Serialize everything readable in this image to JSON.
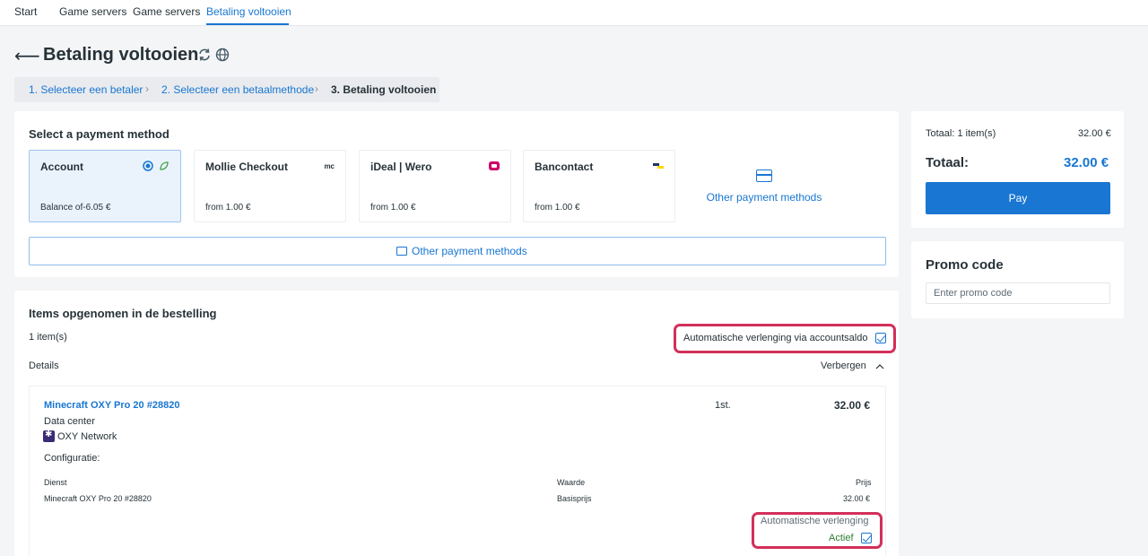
{
  "breadcrumb": [
    "Start",
    "Game servers",
    "Game servers",
    "Betaling voltooien"
  ],
  "page": {
    "title": "Betaling voltooien",
    "icons": [
      "back-arrow-icon",
      "refresh-icon",
      "globe-icon"
    ]
  },
  "steps": [
    "1. Selecteer een betaler",
    "2. Selecteer een betaalmethode",
    "3. Betaling voltooien"
  ],
  "payment": {
    "heading": "Select a payment method",
    "methods": [
      {
        "name": "Account",
        "sub": "Balance of-6.05 €",
        "selected": true
      },
      {
        "name": "Mollie Checkout",
        "sub": "from 1.00 €",
        "logo": "mc"
      },
      {
        "name": "iDeal | Wero",
        "sub": "from 1.00 €"
      },
      {
        "name": "Bancontact",
        "sub": "from 1.00 €"
      }
    ],
    "other_tile_label": "Other payment methods",
    "other_button_label": "Other payment methods"
  },
  "items": {
    "heading": "Items opgenomen in de bestelling",
    "count": "1 item(s)",
    "auto_renew_label": "Automatische verlenging via accountsaldo",
    "details_label": "Details",
    "hide_label": "Verbergen",
    "product": {
      "name": "Minecraft OXY Pro 20 #28820",
      "qty": "1st.",
      "price": "32.00 €",
      "datacenter_label": "Data center",
      "datacenter": "OXY Network",
      "config_label": "Configuratie:",
      "table": {
        "headers": [
          "Dienst",
          "Waarde",
          "Prijs"
        ],
        "rows": [
          [
            "Minecraft OXY Pro 20 #28820",
            "Basisprijs",
            "32.00 €"
          ]
        ]
      },
      "auto_renew_label": "Automatische verlenging",
      "auto_renew_status": "Actief"
    }
  },
  "summary": {
    "total_items_label": "Totaal: 1 item(s)",
    "total_items_value": "32.00 €",
    "total_label": "Totaal:",
    "total_value": "32.00 €",
    "pay_label": "Pay"
  },
  "promo": {
    "heading": "Promo code",
    "placeholder": "Enter promo code"
  },
  "colors": {
    "accent": "#1976d2",
    "highlight": "#d32f5a",
    "active": "#2e7d32"
  }
}
